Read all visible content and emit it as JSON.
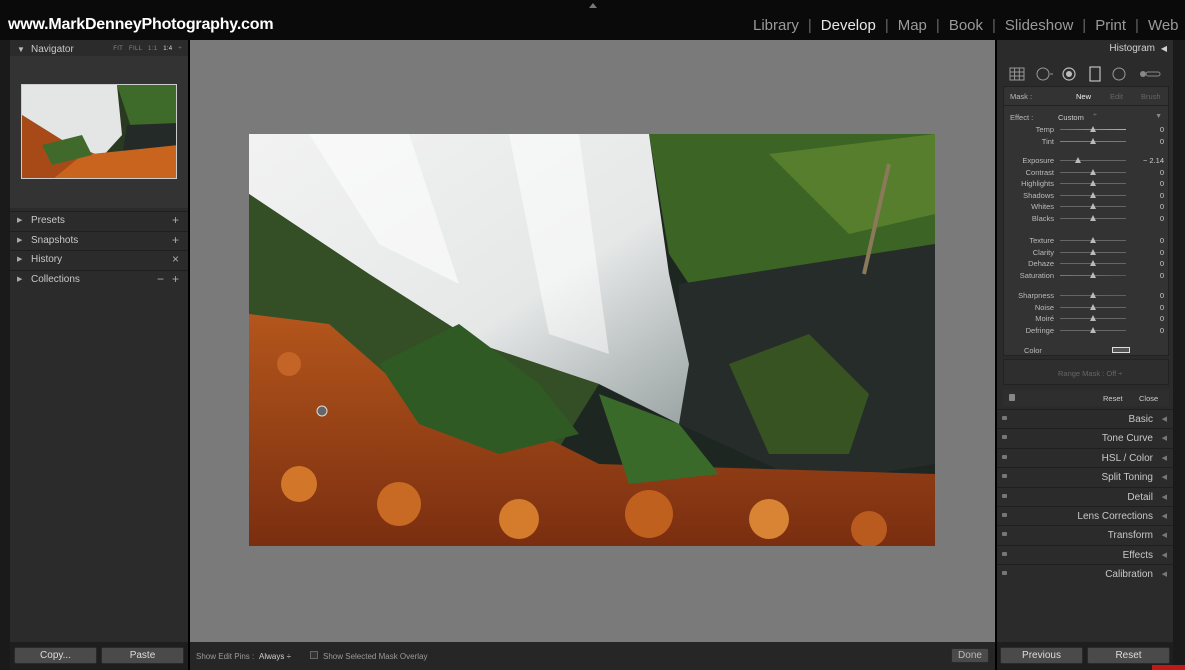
{
  "brand": "www.MarkDenneyPhotography.com",
  "modules": [
    {
      "label": "Library",
      "active": false
    },
    {
      "label": "Develop",
      "active": true
    },
    {
      "label": "Map",
      "active": false
    },
    {
      "label": "Book",
      "active": false
    },
    {
      "label": "Slideshow",
      "active": false
    },
    {
      "label": "Print",
      "active": false
    },
    {
      "label": "Web",
      "active": false
    }
  ],
  "module_separator": "|",
  "navigator": {
    "title": "Navigator",
    "opt_fit": "FIT",
    "opt_fill": "FILL",
    "opt_11": "1:1",
    "opt_14": "1:4",
    "opt_more": "÷"
  },
  "left_sections": [
    {
      "label": "Presets",
      "action": "+"
    },
    {
      "label": "Snapshots",
      "action": "+"
    },
    {
      "label": "History",
      "action": "×"
    },
    {
      "label": "Collections",
      "action": "+",
      "action2": "−"
    }
  ],
  "left_buttons": {
    "copy": "Copy...",
    "paste": "Paste"
  },
  "histogram": {
    "title": "Histogram"
  },
  "mask": {
    "label": "Mask :",
    "new": "New",
    "edit": "Edit",
    "brush": "Brush"
  },
  "effect": {
    "label": "Effect :",
    "value": "Custom"
  },
  "sliders_group1": [
    {
      "label": "Temp",
      "pos": 0.5,
      "value": "0"
    },
    {
      "label": "Tint",
      "pos": 0.5,
      "value": "0"
    }
  ],
  "sliders_group2": [
    {
      "label": "Exposure",
      "pos": 0.27,
      "value": "− 2.14"
    },
    {
      "label": "Contrast",
      "pos": 0.5,
      "value": "0"
    },
    {
      "label": "Highlights",
      "pos": 0.5,
      "value": "0"
    },
    {
      "label": "Shadows",
      "pos": 0.5,
      "value": "0"
    },
    {
      "label": "Whites",
      "pos": 0.5,
      "value": "0"
    },
    {
      "label": "Blacks",
      "pos": 0.5,
      "value": "0"
    }
  ],
  "sliders_group3": [
    {
      "label": "Texture",
      "pos": 0.5,
      "value": "0"
    },
    {
      "label": "Clarity",
      "pos": 0.5,
      "value": "0"
    },
    {
      "label": "Dehaze",
      "pos": 0.5,
      "value": "0"
    },
    {
      "label": "Saturation",
      "pos": 0.5,
      "value": "0"
    }
  ],
  "sliders_group4": [
    {
      "label": "Sharpness",
      "pos": 0.5,
      "value": "0"
    },
    {
      "label": "Noise",
      "pos": 0.5,
      "value": "0"
    },
    {
      "label": "Moiré",
      "pos": 0.5,
      "value": "0"
    },
    {
      "label": "Defringe",
      "pos": 0.5,
      "value": "0"
    }
  ],
  "color_label": "Color",
  "range_mask": "Range Mask : Off ÷",
  "mask_buttons": {
    "reset": "Reset",
    "close": "Close"
  },
  "right_sections": [
    "Basic",
    "Tone Curve",
    "HSL / Color",
    "Split Toning",
    "Detail",
    "Lens Corrections",
    "Transform",
    "Effects",
    "Calibration"
  ],
  "toolbar": {
    "pins_label": "Show Edit Pins :",
    "pins_value": "Always ÷",
    "overlay_label": "Show Selected Mask Overlay",
    "done": "Done"
  },
  "right_buttons": {
    "previous": "Previous",
    "reset": "Reset"
  }
}
